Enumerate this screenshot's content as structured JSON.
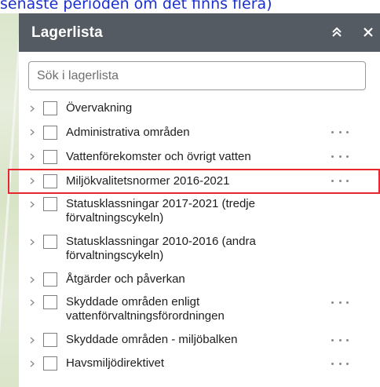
{
  "caption": "senaste perioden om det finns flera)",
  "panel": {
    "title": "Lagerlista",
    "collapse_icon": "double-chevron-up-icon",
    "close_icon": "close-icon"
  },
  "search": {
    "placeholder": "Sök i lagerlista",
    "value": ""
  },
  "layers": [
    {
      "label": "Övervakning",
      "has_menu": false
    },
    {
      "label": "Administrativa områden",
      "has_menu": true
    },
    {
      "label": "Vattenförekomster och övrigt vatten",
      "has_menu": true
    },
    {
      "label": "Miljökvalitetsnormer 2016-2021",
      "has_menu": true,
      "highlighted": true
    },
    {
      "label": "Statusklassningar 2017-2021 (tredje förvaltningscykeln)",
      "has_menu": false
    },
    {
      "label": "Statusklassningar 2010-2016 (andra förvaltningscykeln)",
      "has_menu": false
    },
    {
      "label": "Åtgärder och påverkan",
      "has_menu": false
    },
    {
      "label": "Skyddade områden enligt vattenförvaltningsförordningen",
      "has_menu": true
    },
    {
      "label": "Skyddade områden - miljöbalken",
      "has_menu": true
    },
    {
      "label": "Havsmiljödirektivet",
      "has_menu": true
    }
  ],
  "colors": {
    "header_bg": "#555b63",
    "highlight_border": "#e8262e",
    "caption_text": "#1a2fd0"
  }
}
